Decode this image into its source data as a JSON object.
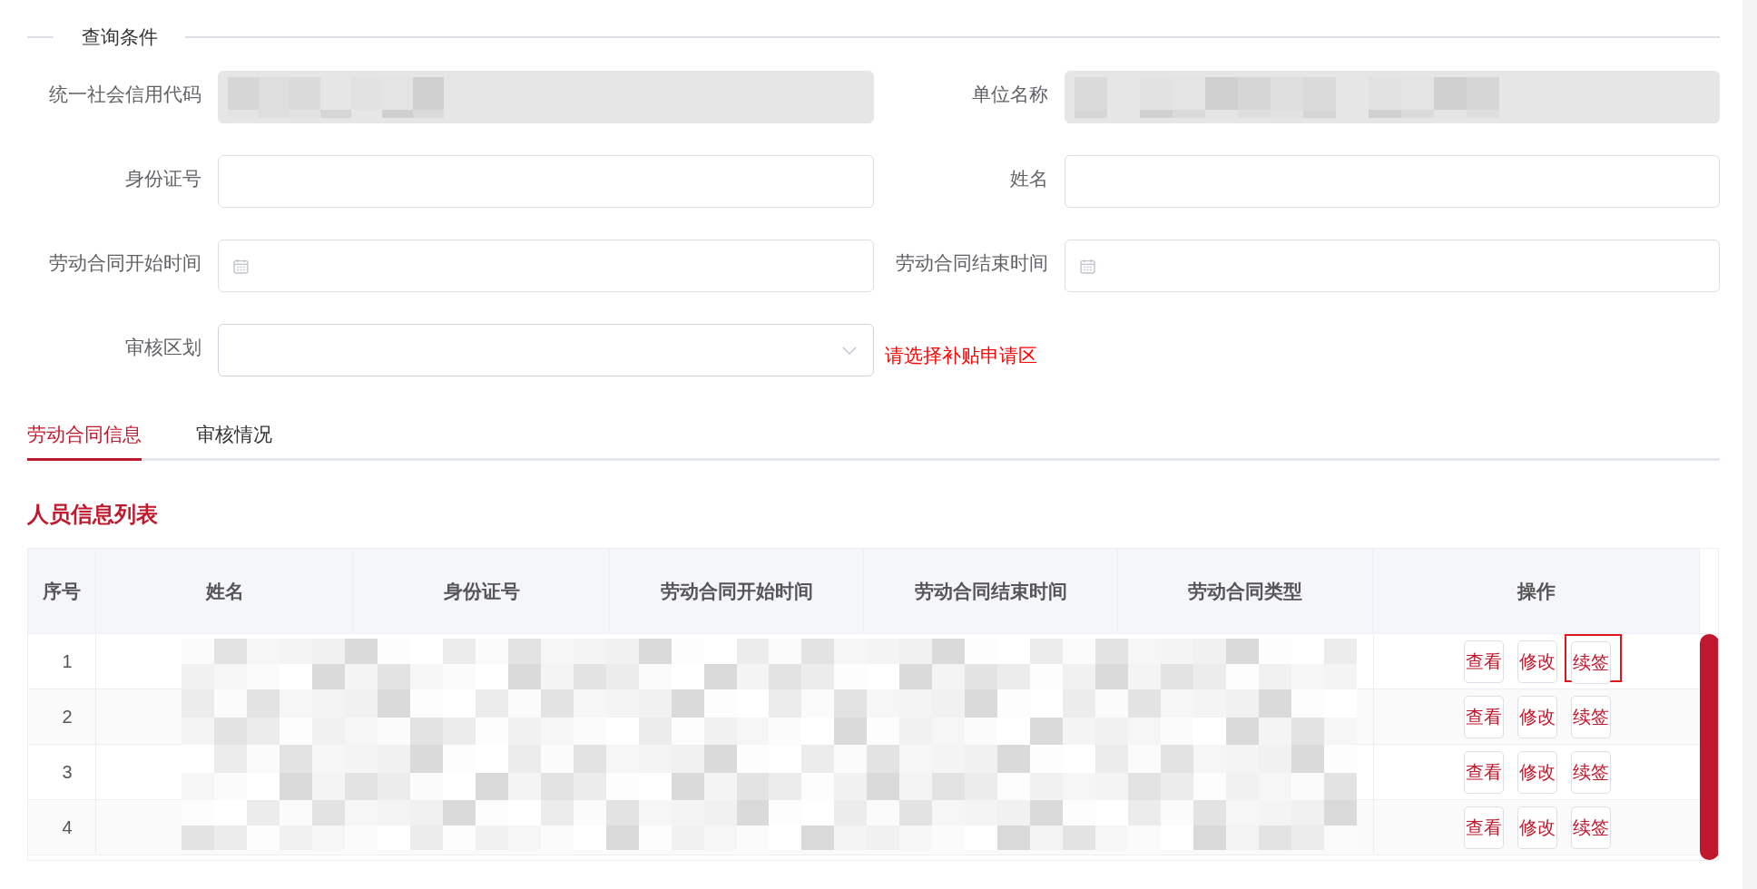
{
  "query_section": {
    "title": "查询条件"
  },
  "fields": [
    {
      "label": "统一社会信用代码",
      "kind": "text",
      "disabled": true,
      "redacted": true
    },
    {
      "label": "单位名称",
      "kind": "text",
      "disabled": true,
      "redacted": true
    },
    {
      "label": "身份证号",
      "kind": "text",
      "disabled": false,
      "redacted": false
    },
    {
      "label": "姓名",
      "kind": "text",
      "disabled": false,
      "redacted": false
    },
    {
      "label": "劳动合同开始时间",
      "kind": "date",
      "disabled": false,
      "redacted": false
    },
    {
      "label": "劳动合同结束时间",
      "kind": "date",
      "disabled": false,
      "redacted": false
    },
    {
      "label": "审核区划",
      "kind": "select",
      "disabled": false,
      "redacted": false,
      "hint": "请选择补贴申请区"
    }
  ],
  "tabs": [
    {
      "label": "劳动合同信息",
      "selected": true
    },
    {
      "label": "审核情况",
      "selected": false
    }
  ],
  "list": {
    "title": "人员信息列表",
    "redacted": true,
    "columns": [
      "序号",
      "姓名",
      "身份证号",
      "劳动合同开始时间",
      "劳动合同结束时间",
      "劳动合同类型",
      "操作"
    ],
    "rows": [
      {
        "index": "1",
        "actions": [
          {
            "label": "查看",
            "highlighted": false
          },
          {
            "label": "修改",
            "highlighted": false
          },
          {
            "label": "续签",
            "highlighted": true
          }
        ]
      },
      {
        "index": "2",
        "actions": [
          {
            "label": "查看",
            "highlighted": false
          },
          {
            "label": "修改",
            "highlighted": false
          },
          {
            "label": "续签",
            "highlighted": false
          }
        ]
      },
      {
        "index": "3",
        "actions": [
          {
            "label": "查看",
            "highlighted": false
          },
          {
            "label": "修改",
            "highlighted": false
          },
          {
            "label": "续签",
            "highlighted": false
          }
        ]
      },
      {
        "index": "4",
        "actions": [
          {
            "label": "查看",
            "highlighted": false
          },
          {
            "label": "修改",
            "highlighted": false
          },
          {
            "label": "续签",
            "highlighted": false
          }
        ]
      }
    ]
  }
}
